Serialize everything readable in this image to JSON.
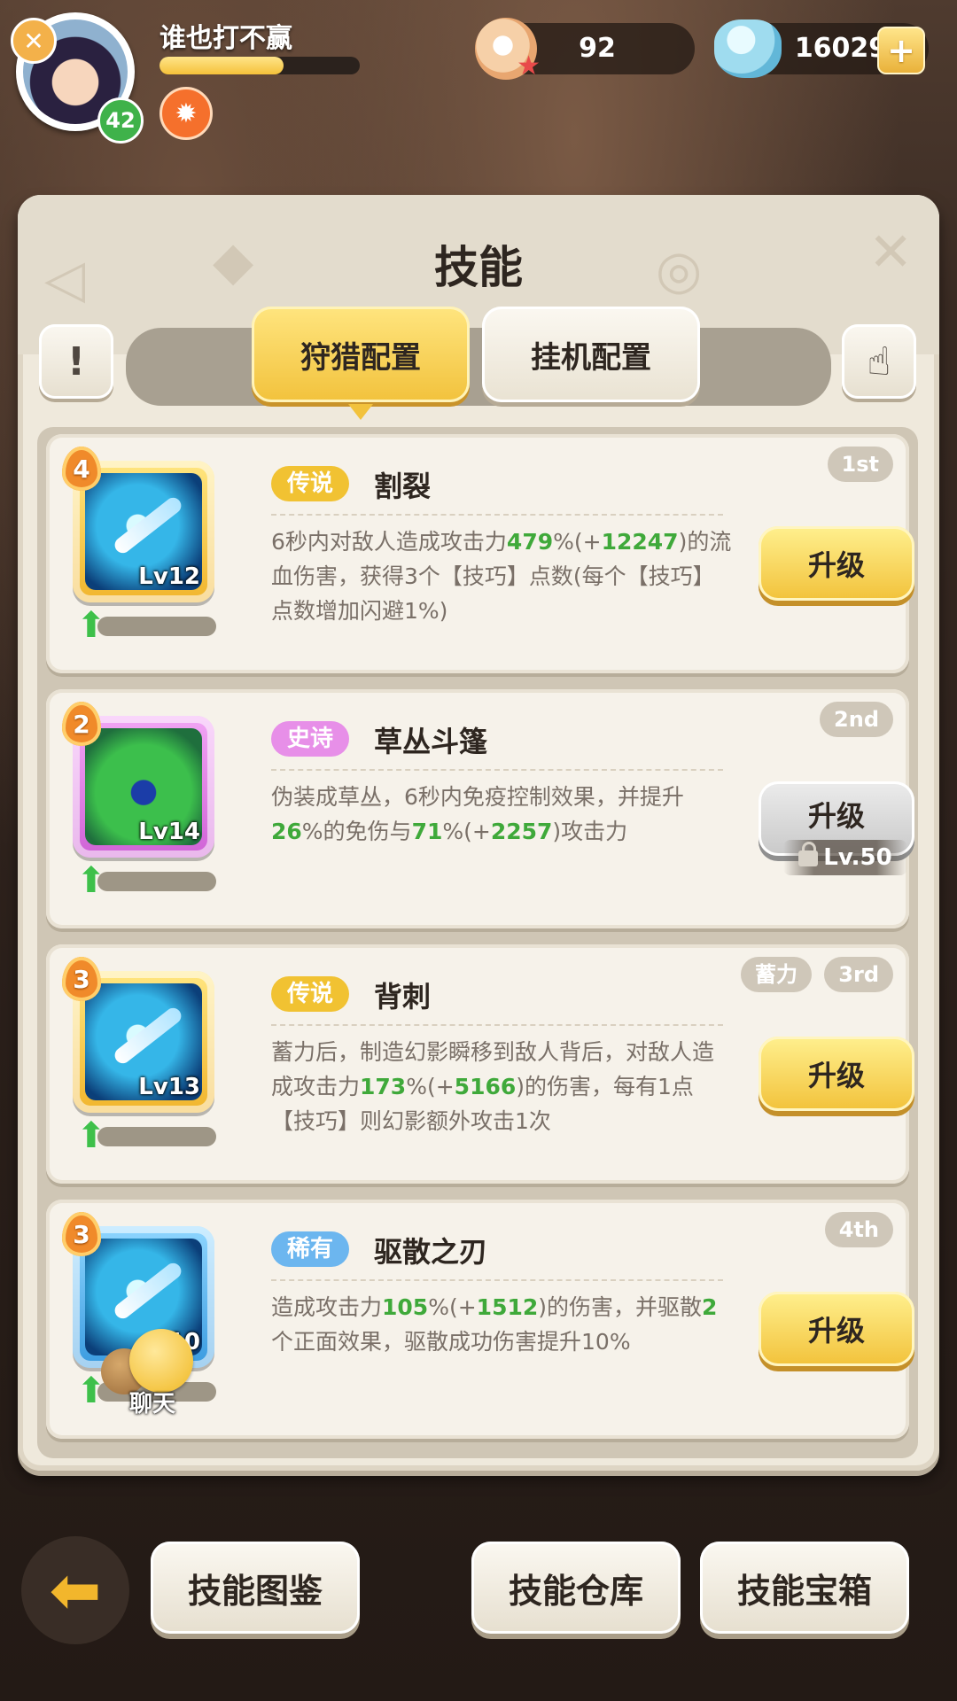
{
  "player": {
    "name": "谁也打不赢",
    "level": "42",
    "xp_fraction": 0.62
  },
  "resources": {
    "pearls": "92",
    "gems": "16029",
    "add_label": "+"
  },
  "panel": {
    "title": "技能",
    "info_label": "!",
    "tabs": [
      {
        "label": "狩猎配置",
        "active": true
      },
      {
        "label": "挂机配置",
        "active": false
      }
    ]
  },
  "skills": [
    {
      "stars": "4",
      "level": "Lv12",
      "rarity": "传说",
      "name": "割裂",
      "rank": "1st",
      "desc": [
        "6秒内对敌人造成攻击力",
        "479",
        "%(+",
        "12247",
        ")的流血伤害，获得3个【技巧】点数(每个【技巧】点数增加闪避1%)"
      ],
      "upgrade": "升级"
    },
    {
      "stars": "2",
      "level": "Lv14",
      "rarity": "史诗",
      "name": "草丛斗篷",
      "rank": "2nd",
      "desc": [
        "伪装成草丛，6秒内免疫控制效果，并提升",
        "26",
        "%的免伤与",
        "71",
        "%(+",
        "2257",
        ")攻击力"
      ],
      "upgrade": "升级",
      "lock_req": "Lv.50"
    },
    {
      "stars": "3",
      "level": "Lv13",
      "rarity": "传说",
      "name": "背刺",
      "rank": "3rd",
      "tag": "蓄力",
      "desc": [
        "蓄力后，制造幻影瞬移到敌人背后，对敌人造成攻击力",
        "173",
        "%(+",
        "5166",
        ")的伤害，每有1点【技巧】则幻影额外攻击1次"
      ],
      "upgrade": "升级"
    },
    {
      "stars": "3",
      "level": "10",
      "rarity": "稀有",
      "name": "驱散之刃",
      "rank": "4th",
      "desc": [
        "造成攻击力",
        "105",
        "%(+",
        "1512",
        ")的伤害，并驱散",
        "2",
        "个正面效果，驱散成功伤害提升10%"
      ],
      "upgrade": "升级"
    }
  ],
  "chat_label": "聊天",
  "bottom_nav": {
    "codex": "技能图鉴",
    "storage": "技能仓库",
    "chest": "技能宝箱"
  },
  "colors": {
    "legend": "#f1c232",
    "epic": "#e78fe8",
    "rare": "#6cb6ef",
    "value_green": "#3fa93a"
  },
  "icons": [
    "close-badge-icon",
    "buff-icon",
    "pearl-icon",
    "gem-icon",
    "plus-icon",
    "info-icon",
    "hand-pointer-icon",
    "lock-icon",
    "up-arrow-icon",
    "back-arrow-icon"
  ]
}
